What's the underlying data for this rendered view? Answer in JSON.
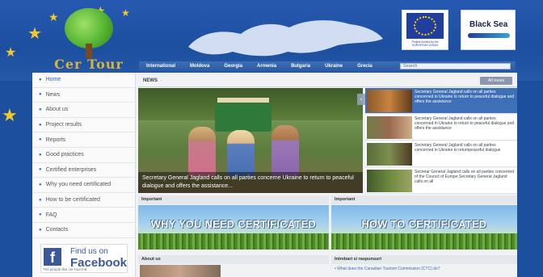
{
  "logo": {
    "name": "Cer Tour"
  },
  "nav": {
    "items": [
      "International",
      "Moldova",
      "Georgia",
      "Armenia",
      "Bulgaria",
      "Ukraine",
      "Grecia"
    ],
    "search_placeholder": "Search"
  },
  "badges": {
    "eu_caption": "Project funded by the EUROPEAN UNION",
    "bs_name": "Black Sea"
  },
  "sidebar": {
    "items": [
      "Home",
      "News",
      "About us",
      "Project results",
      "Reports",
      "Good practices",
      "Certified enterprises",
      "Why you need certificated",
      "How to be certificated",
      "FAQ",
      "Contacts"
    ],
    "active_index": 0
  },
  "facebook": {
    "line1": "Find us on",
    "line2": "Facebook",
    "small": "763 people like cer-tour.md"
  },
  "news": {
    "title": "NEWS",
    "all_news": "All news",
    "feature_caption": "Secretary General Jagland calls on all parties concerne Ukraine to return to peaceful dialogue and offers the assistance...",
    "side_items": [
      "Secretary General Jagland calls on all parties concerned in Ukraine to return to peaceful dialogue and offers the assistance",
      "Secretary General Jagland calls on all parties concerned in Ukraine to return to peaceful dialogue and offers the assistance",
      "Secretary General Jagland calls on all parties concerned in Ukraine to returnpeaceful dialogue",
      "Secretar General Jagland calls on all parties concerned of the Council of Europe Secretary General Jagland calls on all"
    ]
  },
  "sections": {
    "important_left": "Important",
    "important_right": "Important",
    "banner_left": "WHY YOU NEED CERTIFICATED",
    "banner_right": "HOW TO CERTIFICATED",
    "about_us": "About us",
    "interbari": "Intrebari si raspunsuri",
    "faq_link": "• What does the Canadian Tourism Commission (CTC) do?"
  },
  "colors": {
    "brand_blue": "#1c4f9c",
    "accent_yellow": "#f3c82c",
    "active_news": "#3f6fb6"
  }
}
